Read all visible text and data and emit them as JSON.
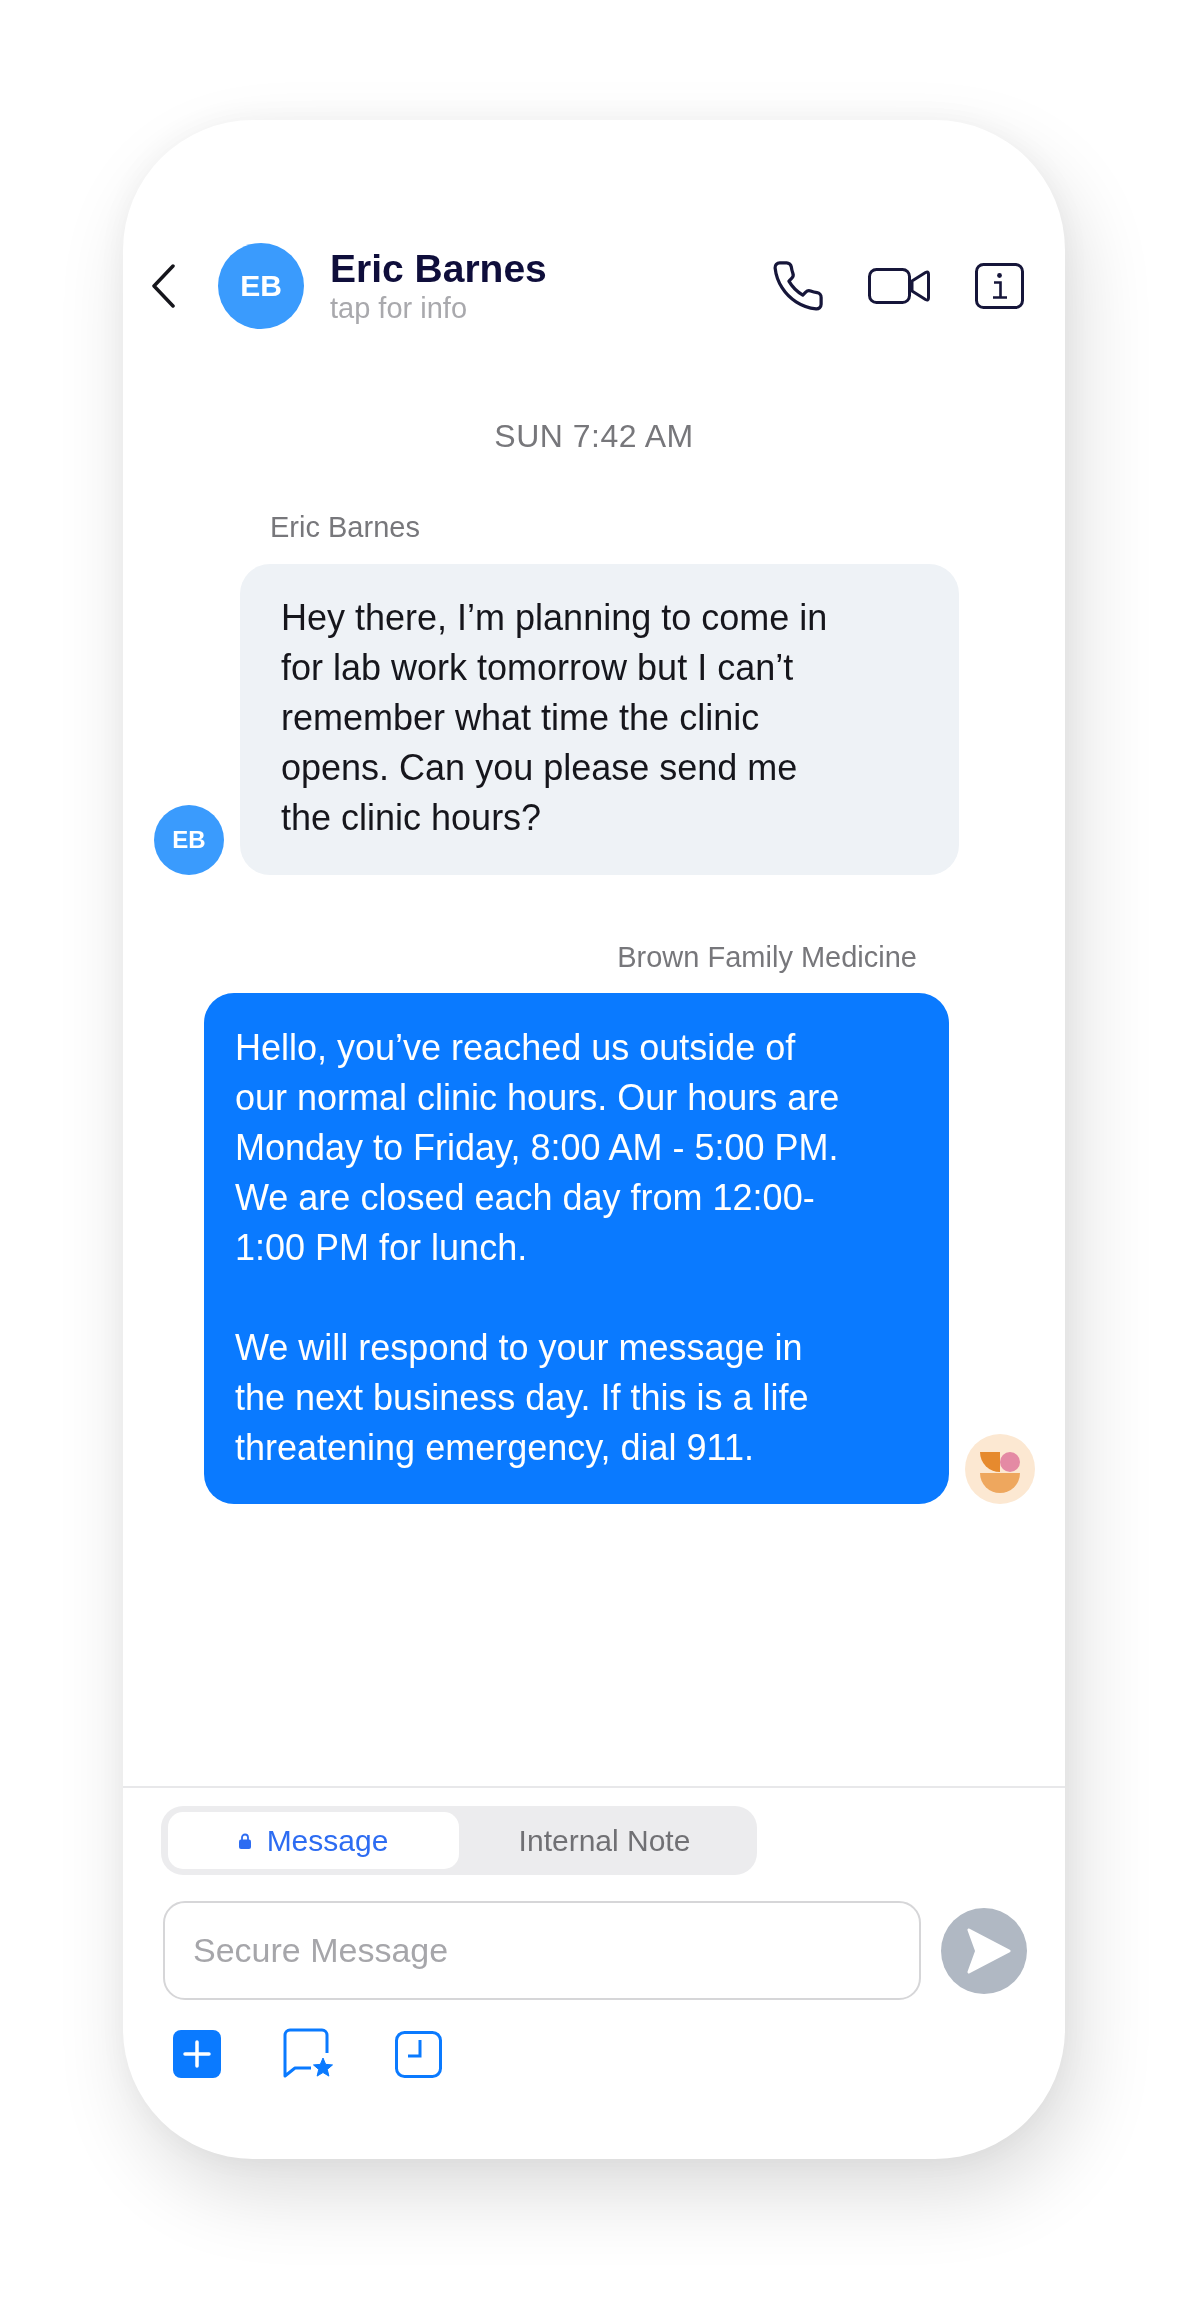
{
  "header": {
    "avatar_initials": "EB",
    "name": "Eric Barnes",
    "subtitle": "tap for info"
  },
  "timestamp": "SUN 7:42 AM",
  "messages": [
    {
      "kind": "incoming",
      "sender": "Eric Barnes",
      "avatar_initials": "EB",
      "paragraphs": [
        "Hey there, I’m planning to come in for lab work tomorrow but I can’t remember what time the clinic opens. Can you please send me the clinic hours?"
      ]
    },
    {
      "kind": "outgoing",
      "sender": "Brown Family Medicine",
      "paragraphs": [
        "Hello, you’ve reached us outside of our normal clinic hours. Our hours are Monday to Friday, 8:00 AM - 5:00 PM. We are closed each day from 12:00-1:00 PM for lunch.",
        "We will respond to your message in the next business day. If this is a life threatening emergency, dial 911."
      ]
    }
  ],
  "composer": {
    "tabs": [
      {
        "label": "Message",
        "selected": true,
        "locked": true
      },
      {
        "label": "Internal Note",
        "selected": false,
        "locked": false
      }
    ],
    "placeholder": "Secure Message",
    "send_button": {
      "disabled": true
    }
  }
}
